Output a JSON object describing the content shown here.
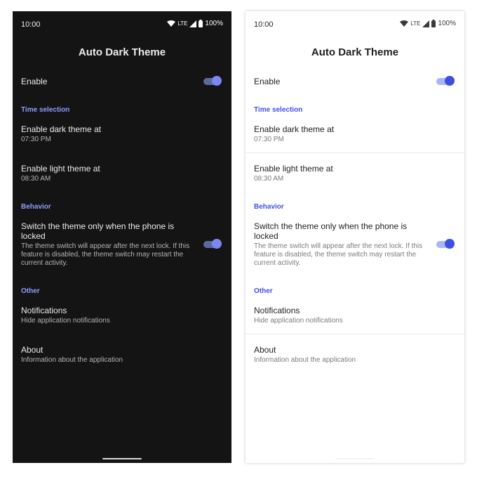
{
  "status_bar": {
    "time": "10:00",
    "network": "LTE",
    "battery": "100%"
  },
  "title": "Auto Dark Theme",
  "enable": {
    "label": "Enable",
    "on": true
  },
  "sections": {
    "time": "Time selection",
    "behavior": "Behavior",
    "other": "Other"
  },
  "dark_theme": {
    "label": "Enable dark theme at",
    "value": "07:30 PM"
  },
  "light_theme": {
    "label": "Enable light theme at",
    "value": "08:30 AM"
  },
  "switch_locked": {
    "label": "Switch the theme only when the phone is locked",
    "description": "The theme switch will appear after the next lock. If this feature is disabled, the theme switch may restart the current activity.",
    "on": true
  },
  "notifications": {
    "label": "Notifications",
    "description": "Hide application notifications"
  },
  "about": {
    "label": "About",
    "description": "Information about the application"
  },
  "colors": {
    "dark_background": "#141414",
    "dark_accent": "#8c9eff",
    "light_background": "#ffffff",
    "light_accent": "#3f51e6"
  }
}
